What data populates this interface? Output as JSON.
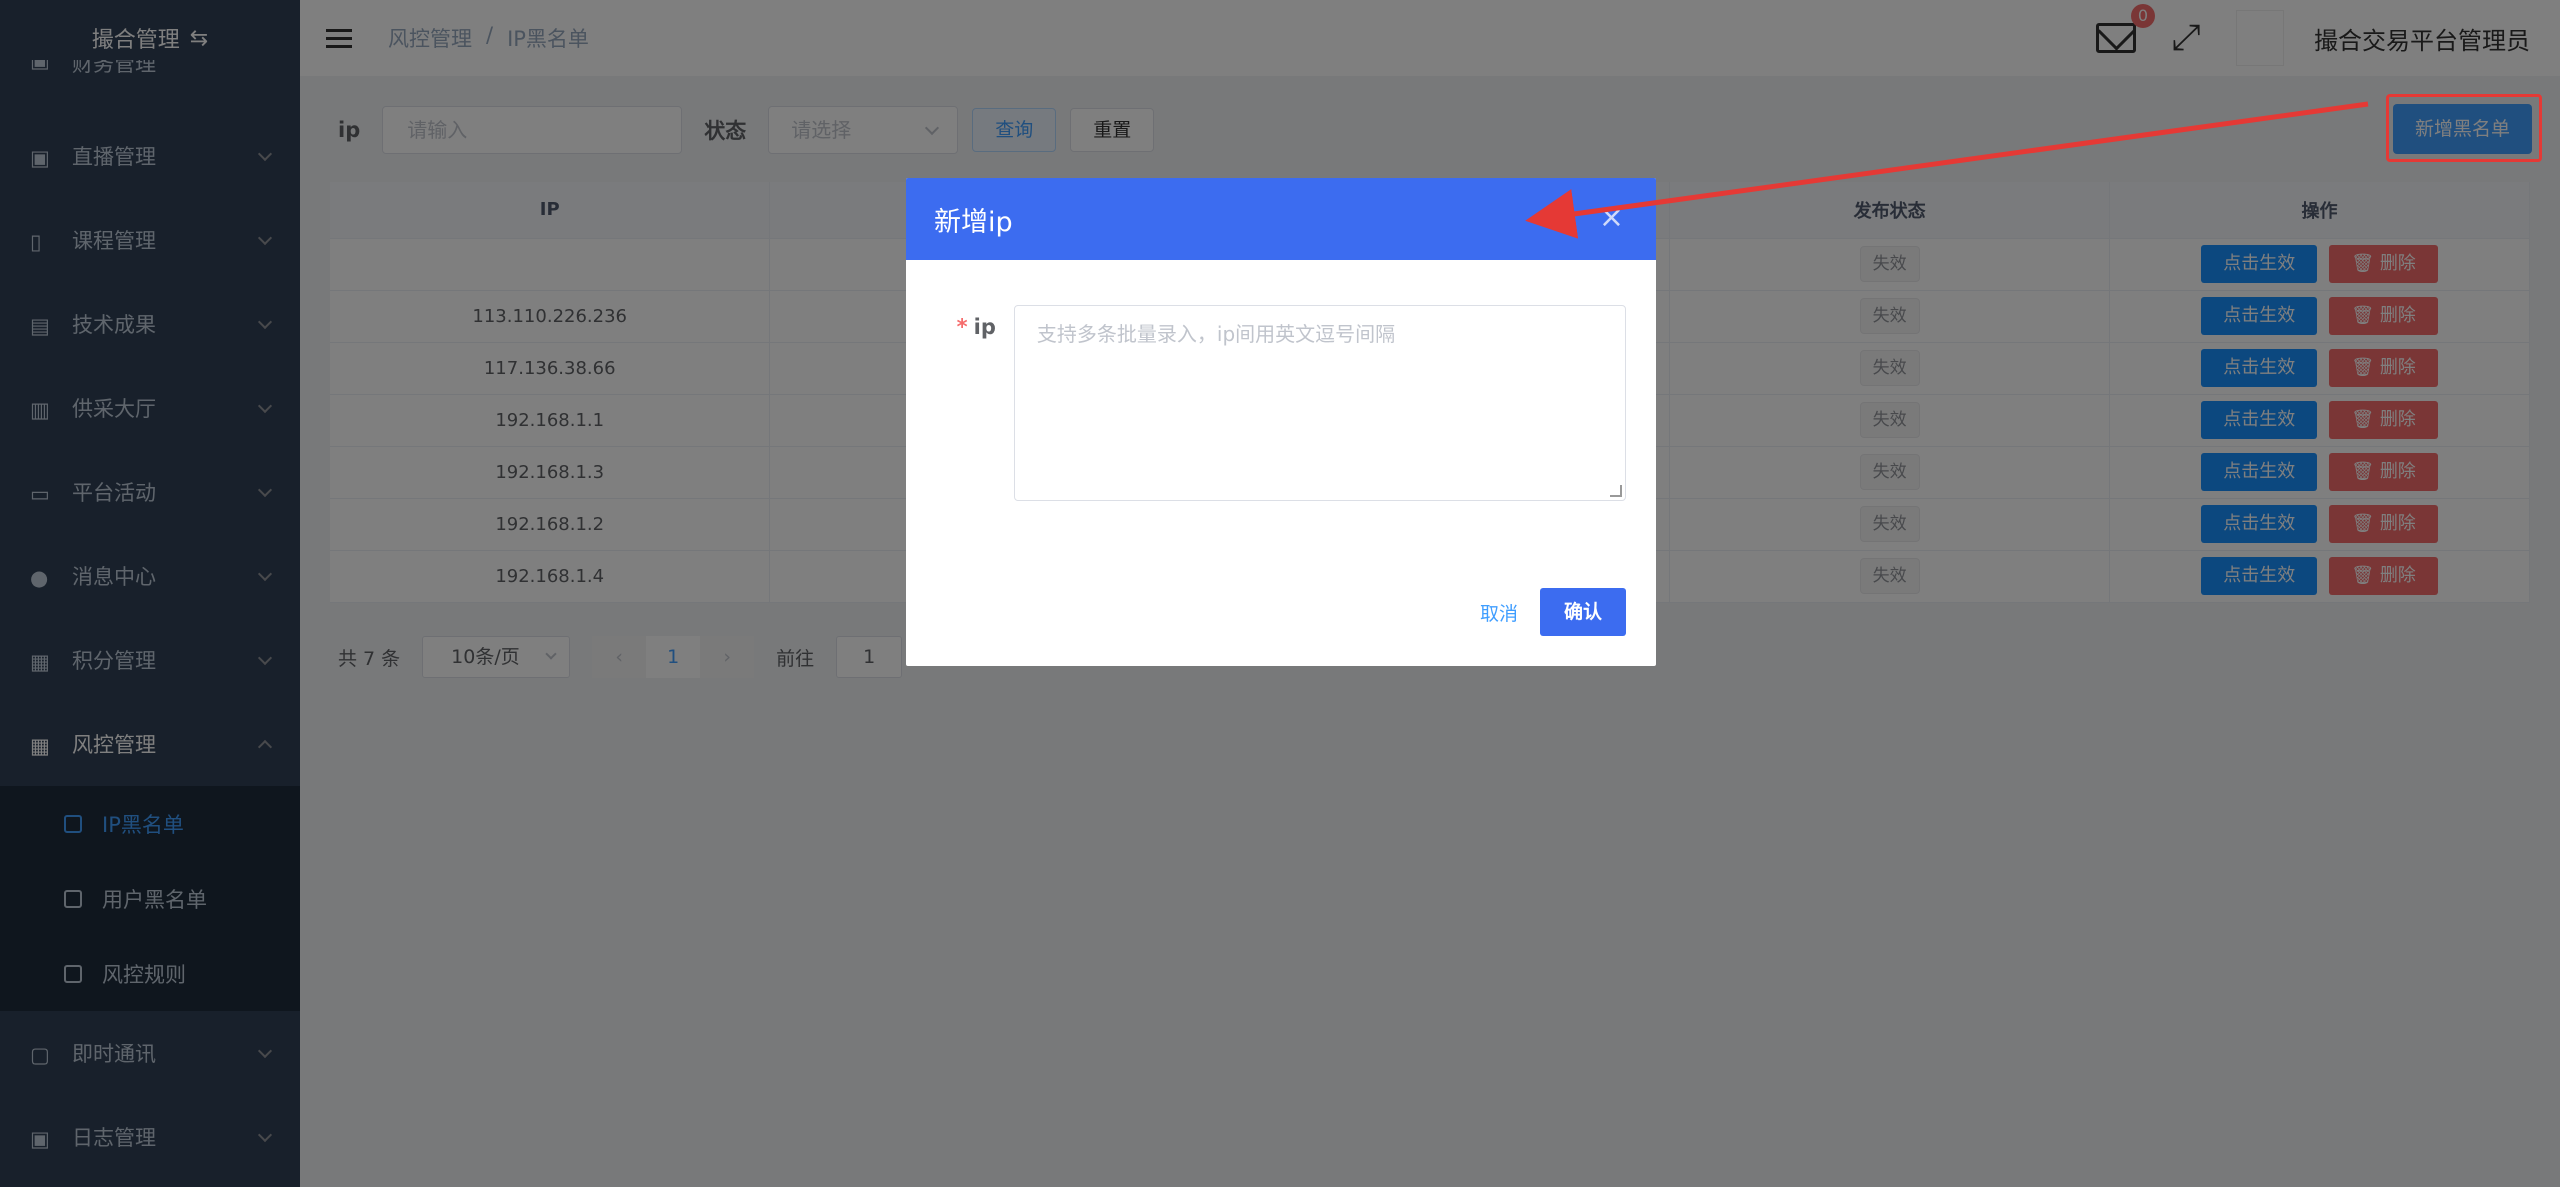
{
  "sidebar": {
    "title": "撮合管理",
    "partial_item": "财务管理",
    "items": [
      {
        "label": "直播管理"
      },
      {
        "label": "课程管理"
      },
      {
        "label": "技术成果"
      },
      {
        "label": "供采大厅"
      },
      {
        "label": "平台活动"
      },
      {
        "label": "消息中心"
      },
      {
        "label": "积分管理"
      },
      {
        "label": "风控管理"
      }
    ],
    "sub_items": [
      {
        "label": "IP黑名单"
      },
      {
        "label": "用户黑名单"
      },
      {
        "label": "风控规则"
      }
    ],
    "bottom_items": [
      {
        "label": "即时通讯"
      },
      {
        "label": "日志管理"
      }
    ]
  },
  "header": {
    "breadcrumb": [
      "风控管理",
      "/",
      "IP黑名单"
    ],
    "mail_badge": "0",
    "username": "撮合交易平台管理员"
  },
  "search": {
    "ip_label": "ip",
    "ip_placeholder": "请输入",
    "status_label": "状态",
    "status_placeholder": "请选择",
    "query_label": "查询",
    "reset_label": "重置",
    "add_label": "新增黑名单"
  },
  "table": {
    "headers": [
      "IP",
      "",
      "",
      "发布状态",
      "操作"
    ],
    "rows": [
      {
        "ip": "",
        "status": "失效"
      },
      {
        "ip": "113.110.226.236",
        "status": "失效"
      },
      {
        "ip": "117.136.38.66",
        "status": "失效"
      },
      {
        "ip": "192.168.1.1",
        "status": "失效"
      },
      {
        "ip": "192.168.1.3",
        "status": "失效"
      },
      {
        "ip": "192.168.1.2",
        "status": "失效"
      },
      {
        "ip": "192.168.1.4",
        "status": "失效"
      }
    ],
    "activate_label": "点击生效",
    "delete_label": "删除"
  },
  "pagination": {
    "total": "共 7 条",
    "page_size": "10条/页",
    "current": "1",
    "goto_label": "前往",
    "goto_value": "1"
  },
  "dialog": {
    "title": "新增ip",
    "field_label": "ip",
    "required_mark": "*",
    "placeholder": "支持多条批量录入，ip间用英文逗号间隔",
    "cancel_label": "取消",
    "confirm_label": "确认"
  },
  "colors": {
    "sidebar_bg": "#304156",
    "primary": "#3c6cf0",
    "danger": "#f56c6c",
    "annotation": "#e53935"
  }
}
